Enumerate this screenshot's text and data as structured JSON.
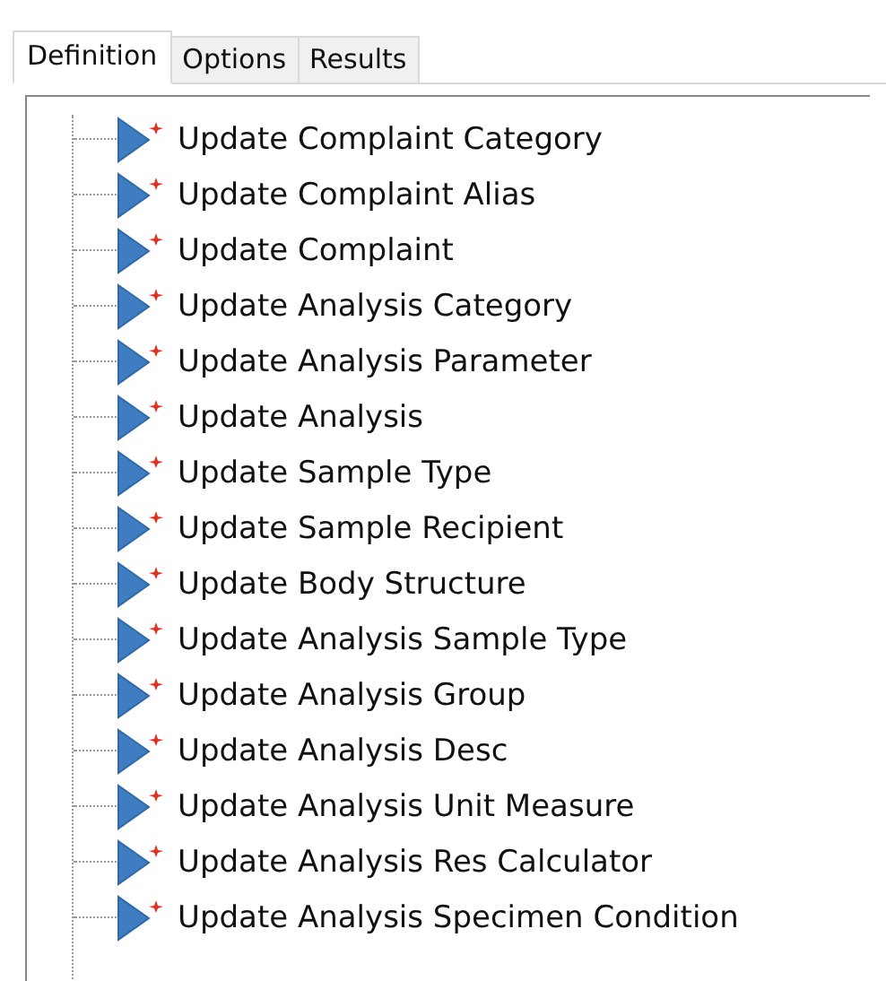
{
  "tabs": [
    {
      "label": "Definition",
      "selected": true
    },
    {
      "label": "Options",
      "selected": false
    },
    {
      "label": "Results",
      "selected": false
    }
  ],
  "tree": {
    "items": [
      {
        "label": "Update Complaint Category"
      },
      {
        "label": "Update Complaint Alias"
      },
      {
        "label": "Update Complaint"
      },
      {
        "label": "Update Analysis Category"
      },
      {
        "label": "Update Analysis Parameter"
      },
      {
        "label": "Update Analysis"
      },
      {
        "label": "Update Sample Type"
      },
      {
        "label": "Update Sample Recipient"
      },
      {
        "label": "Update Body Structure"
      },
      {
        "label": "Update Analysis Sample Type"
      },
      {
        "label": "Update Analysis Group"
      },
      {
        "label": "Update Analysis Desc"
      },
      {
        "label": "Update Analysis Unit Measure"
      },
      {
        "label": "Update Analysis Res Calculator"
      },
      {
        "label": "Update Analysis Specimen Condition"
      }
    ]
  }
}
